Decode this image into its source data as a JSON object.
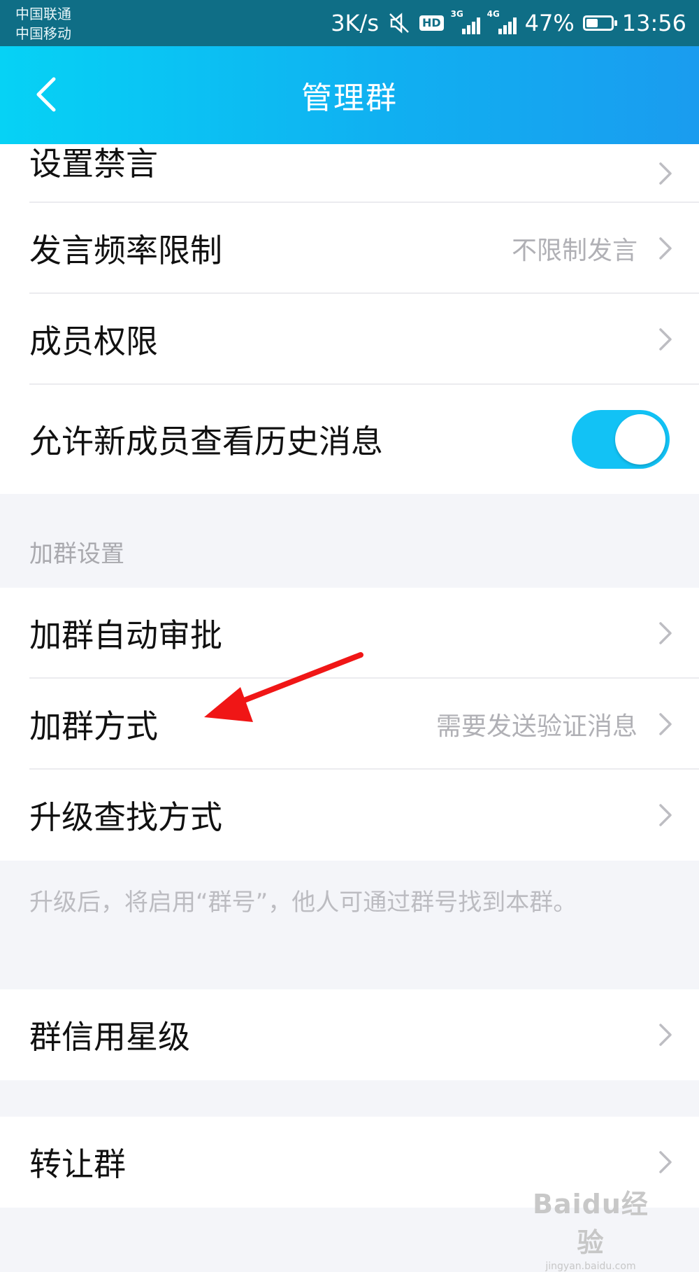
{
  "status_bar": {
    "carrier_1": "中国联通",
    "carrier_2": "中国移动",
    "net_speed": "3K/s",
    "hd_label": "HD",
    "signal_1_type": "3G",
    "signal_2_type": "4G",
    "battery_percent": "47%",
    "battery_level": 0.47,
    "time": "13:56",
    "icons": [
      "mute-icon",
      "hd-icon",
      "signal-3g-icon",
      "signal-4g-icon",
      "battery-icon"
    ]
  },
  "header": {
    "title": "管理群",
    "back_icon": "chevron-left-icon",
    "background_colors": [
      "#06d2f5",
      "#1a9cef"
    ]
  },
  "group_list_1": {
    "items": [
      {
        "label": "设置禁言",
        "value": ""
      },
      {
        "label": "发言频率限制",
        "value": "不限制发言"
      },
      {
        "label": "成员权限",
        "value": ""
      },
      {
        "label": "允许新成员查看历史消息",
        "toggle_on": true
      }
    ]
  },
  "join_section": {
    "header": "加群设置",
    "items": [
      {
        "label": "加群自动审批",
        "value": ""
      },
      {
        "label": "加群方式",
        "value": "需要发送验证消息"
      },
      {
        "label": "升级查找方式",
        "value": ""
      }
    ],
    "hint": "升级后，将启用“群号”，他人可通过群号找到本群。"
  },
  "credit_section": {
    "label": "群信用星级"
  },
  "transfer_section": {
    "label": "转让群"
  },
  "annotation": {
    "arrow_color": "#f01616",
    "target": "加群方式"
  },
  "watermark": {
    "logo": "Baidu经验",
    "url": "jingyan.baidu.com"
  },
  "colors": {
    "accent": "#12c2f5",
    "page_background": "#f4f5f9",
    "secondary_text": "#b0b0b5"
  }
}
